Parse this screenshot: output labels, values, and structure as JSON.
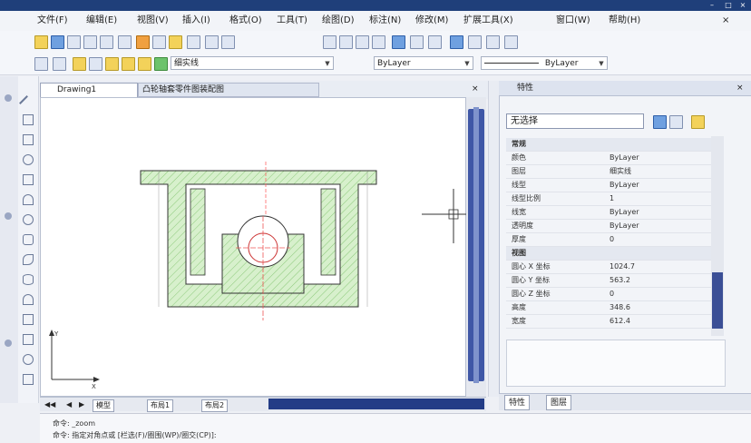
{
  "menubar": {
    "items": [
      "文件(F)",
      "编辑(E)",
      "视图(V)",
      "插入(I)",
      "格式(O)",
      "工具(T)",
      "绘图(D)",
      "标注(N)",
      "修改(M)",
      "扩展工具(X)",
      "窗口(W)",
      "帮助(H)"
    ]
  },
  "toolbar2": {
    "layer_name": "细实线",
    "linetype_value": "ByLayer",
    "lineweight_value": "ByLayer"
  },
  "document": {
    "tab_label": "Drawing1",
    "tab2_label": "凸轮轴套零件图装配图"
  },
  "layout_tabs": [
    "模型",
    "布局1",
    "布局2"
  ],
  "properties": {
    "title": "特性",
    "selection": "无选择",
    "rows": [
      {
        "key": "常规",
        "value": "",
        "category": true
      },
      {
        "key": "颜色",
        "value": "ByLayer"
      },
      {
        "key": "图层",
        "value": "细实线"
      },
      {
        "key": "线型",
        "value": "ByLayer"
      },
      {
        "key": "线型比例",
        "value": "1"
      },
      {
        "key": "线宽",
        "value": "ByLayer"
      },
      {
        "key": "透明度",
        "value": "ByLayer"
      },
      {
        "key": "厚度",
        "value": "0"
      },
      {
        "key": "视图",
        "value": "",
        "category": true
      },
      {
        "key": "圆心 X 坐标",
        "value": "1024.7"
      },
      {
        "key": "圆心 Y 坐标",
        "value": "563.2"
      },
      {
        "key": "圆心 Z 坐标",
        "value": "0"
      },
      {
        "key": "高度",
        "value": "348.6"
      },
      {
        "key": "宽度",
        "value": "612.4"
      }
    ],
    "tabs": [
      "特性",
      "图层"
    ]
  },
  "command": {
    "line1": "命令: _zoom",
    "line2": "命令: 指定对角点或 [栏选(F)/圈围(WP)/圈交(CP)]:"
  }
}
